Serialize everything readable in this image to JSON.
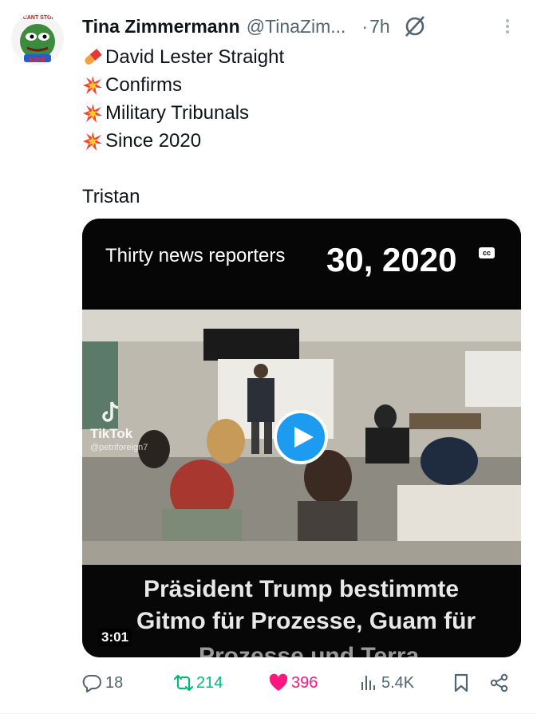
{
  "avatar": {
    "top_text": "I CANT STOP",
    "bottom_text": "LOVE"
  },
  "header": {
    "display_name": "Tina Zimmermann",
    "handle": "@TinaZim...",
    "separator": "·",
    "time": "7h",
    "more_icon": "more-vertical-icon",
    "status_icon": "null-circle-icon"
  },
  "tweet": {
    "lines": [
      {
        "emoji": "pill-emoji",
        "text": "David Lester Straight"
      },
      {
        "emoji": "collision-emoji",
        "text": "Confirms"
      },
      {
        "emoji": "collision-emoji",
        "text": "Military Tribunals"
      },
      {
        "emoji": "collision-emoji",
        "text": "Since 2020"
      }
    ],
    "signature": "Tristan"
  },
  "media": {
    "caption_title": "Thirty news reporters",
    "date_text": "30, 2020",
    "cc_label": "cc",
    "tiktok_label": "TikTok",
    "tiktok_user": "@petriforeign7",
    "subtitle_line1": "Präsident Trump bestimmte",
    "subtitle_line2": "Gitmo für Prozesse, Guam für",
    "subtitle_line3": "Prozesse und Terra",
    "duration": "3:01"
  },
  "actions": {
    "replies": "18",
    "retweets": "214",
    "likes": "396",
    "views": "5.4K",
    "colors": {
      "retweet": "#00ba7c",
      "like": "#f91880",
      "play": "#1d9bf0"
    }
  }
}
